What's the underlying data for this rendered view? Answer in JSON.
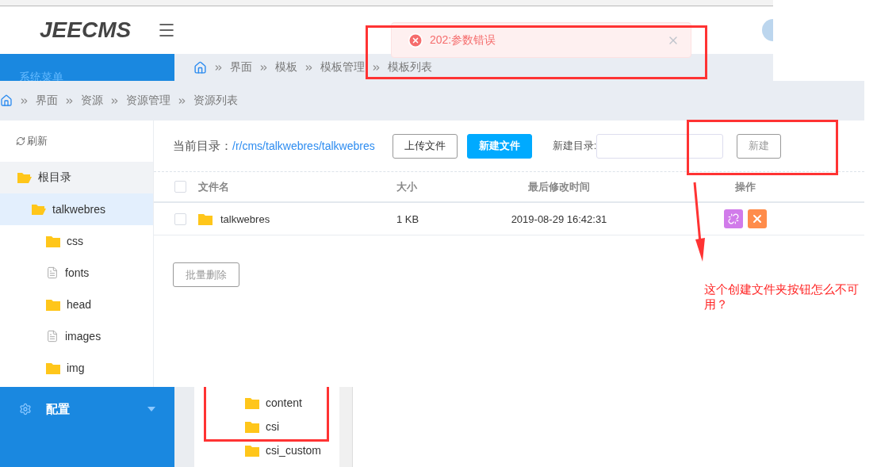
{
  "header": {
    "logo": "JEECMS"
  },
  "back_sidebar": {
    "title": "系统菜单",
    "menu": [
      {
        "label": "配置",
        "expanded": false
      }
    ]
  },
  "back_breadcrumb": [
    "界面",
    "模板",
    "模板管理",
    "模板列表"
  ],
  "back_tree": [
    {
      "label": "content",
      "kind": "folder"
    },
    {
      "label": "csi",
      "kind": "folder"
    },
    {
      "label": "csi_custom",
      "kind": "folder"
    }
  ],
  "toast": {
    "message": "202:参数错误"
  },
  "resource": {
    "breadcrumb": [
      "界面",
      "资源",
      "资源管理",
      "资源列表"
    ],
    "refresh": "刷新",
    "tree": [
      {
        "label": "根目录",
        "kind": "folder",
        "expanded": true,
        "selected": false,
        "highlighted": true,
        "children": [
          {
            "label": "talkwebres",
            "kind": "folder",
            "expanded": true,
            "selected": true,
            "children": [
              {
                "label": "css",
                "kind": "folder",
                "expanded": false,
                "selected": false
              },
              {
                "label": "fonts",
                "kind": "file",
                "expanded": false,
                "selected": false
              },
              {
                "label": "head",
                "kind": "folder",
                "expanded": false,
                "selected": false
              },
              {
                "label": "images",
                "kind": "file",
                "expanded": false,
                "selected": false
              },
              {
                "label": "img",
                "kind": "folder",
                "expanded": false,
                "selected": false
              }
            ]
          }
        ]
      }
    ],
    "current_dir_label": "当前目录：",
    "current_dir": "/r/cms/talkwebres/talkwebres",
    "actions": [
      {
        "label": "上传文件",
        "kind": "outline"
      },
      {
        "label": "新建文件",
        "kind": "primary"
      }
    ],
    "new_dir": {
      "label": "新建目录:",
      "button": "新建",
      "disabled": true
    },
    "table": {
      "all_checked": false,
      "columns": [
        "文件名",
        "大小",
        "最后修改时间",
        "操作"
      ],
      "rows": [
        {
          "checked": false,
          "kind": "folder",
          "name": "talkwebres",
          "size": "1 KB",
          "modified": "2019-08-29 16:42:31",
          "ops": [
            {
              "kind": "unlink",
              "color": "#d17bea"
            },
            {
              "kind": "delete",
              "color": "#ff8c4b"
            }
          ]
        }
      ]
    },
    "batch_delete": {
      "label": "批量删除",
      "disabled": true
    }
  },
  "annotation": {
    "note": "这个创建文件夹按钮怎么不可用？"
  }
}
